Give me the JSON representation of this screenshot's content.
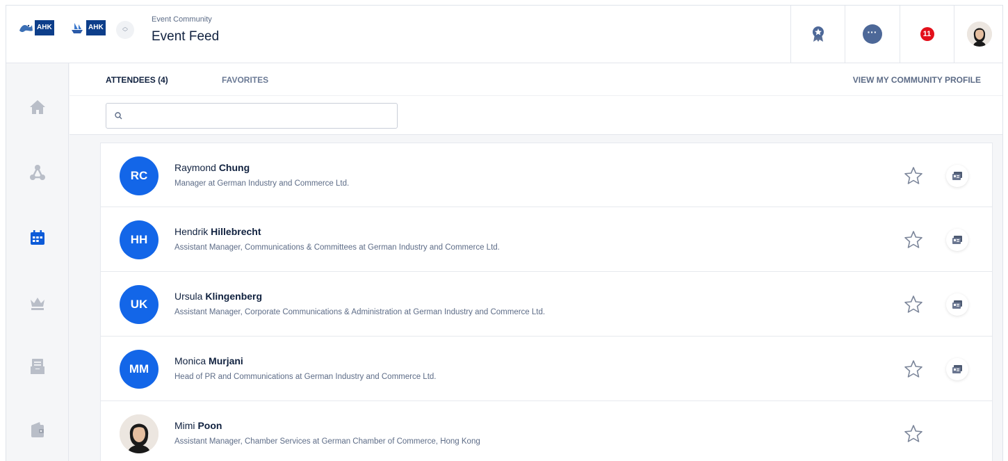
{
  "header": {
    "logos": [
      {
        "text": "AHK"
      },
      {
        "text": "AHK"
      }
    ],
    "subtitle": "Event Community",
    "title": "Event Feed",
    "notification_count": "11",
    "chat_glyph": "···"
  },
  "sidebar": {
    "items": [
      {
        "icon": "home-icon",
        "active": false
      },
      {
        "icon": "network-icon",
        "active": false
      },
      {
        "icon": "calendar-icon",
        "active": true
      },
      {
        "icon": "crown-icon",
        "active": false
      },
      {
        "icon": "inbox-icon",
        "active": false
      },
      {
        "icon": "wallet-icon",
        "active": false
      }
    ]
  },
  "tabs": {
    "attendees": "ATTENDEES (4)",
    "favorites": "FAVORITES",
    "profile_link": "VIEW MY COMMUNITY PROFILE"
  },
  "search": {
    "placeholder": "",
    "value": ""
  },
  "attendees": [
    {
      "initials": "RC",
      "first": "Raymond",
      "last": "Chung",
      "title": "Manager at German Industry and Commerce Ltd.",
      "has_card": true,
      "photo": false
    },
    {
      "initials": "HH",
      "first": "Hendrik",
      "last": "Hillebrecht",
      "title": "Assistant Manager, Communications & Committees at German Industry and Commerce Ltd.",
      "has_card": true,
      "photo": false
    },
    {
      "initials": "UK",
      "first": "Ursula",
      "last": "Klingenberg",
      "title": "Assistant Manager, Corporate Communications & Administration at German Industry and Commerce Ltd.",
      "has_card": true,
      "photo": false
    },
    {
      "initials": "MM",
      "first": "Monica",
      "last": "Murjani",
      "title": "Head of PR and Communications at German Industry and Commerce Ltd.",
      "has_card": true,
      "photo": false
    },
    {
      "initials": "",
      "first": "Mimi",
      "last": "Poon",
      "title": "Assistant Manager, Chamber Services at German Chamber of Commerce, Hong Kong",
      "has_card": false,
      "photo": true
    }
  ],
  "colors": {
    "accent": "#1366e8",
    "nav_active": "#0d5bd8",
    "nav_icon": "#b9bec8",
    "badge": "#e3101b"
  }
}
